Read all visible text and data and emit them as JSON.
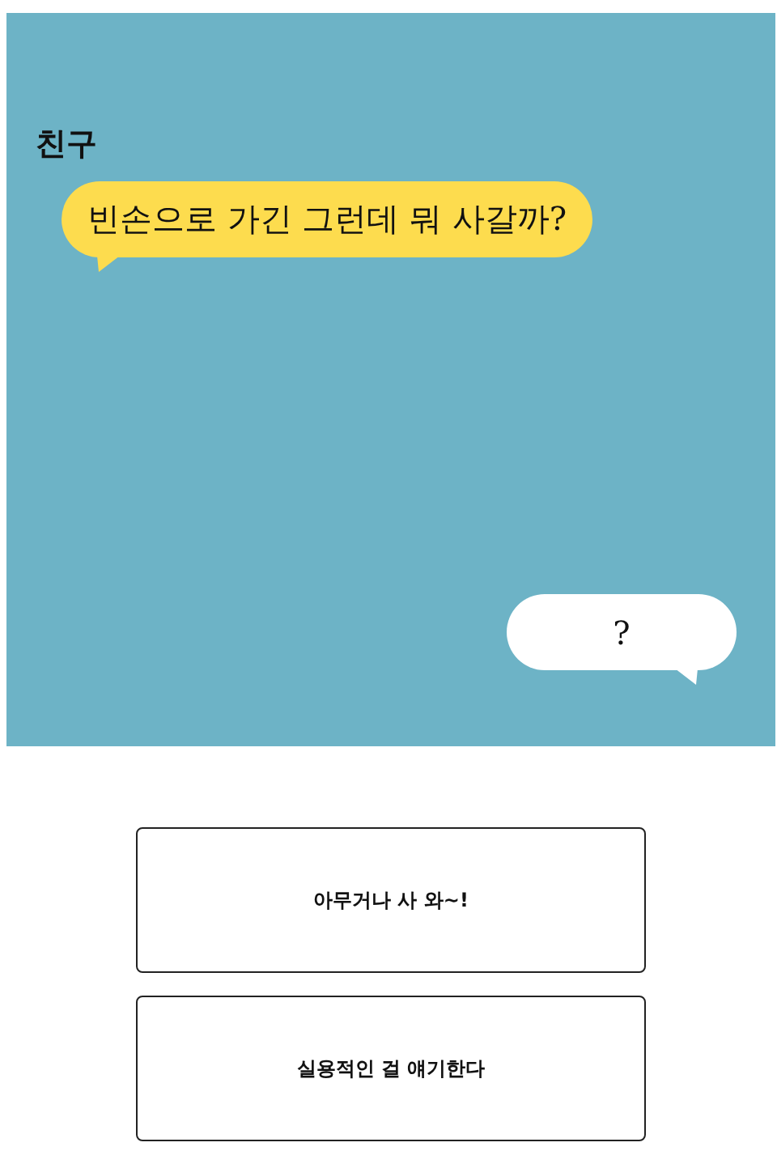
{
  "scene": {
    "speaker": "친구",
    "messages": [
      {
        "kind": "incoming",
        "text": "빈손으로 가긴 그런데 뭐 사갈까?"
      },
      {
        "kind": "outgoing",
        "text": "?"
      }
    ]
  },
  "choices": [
    {
      "label": "아무거나 사 와~!"
    },
    {
      "label": "실용적인 걸 얘기한다"
    }
  ]
}
